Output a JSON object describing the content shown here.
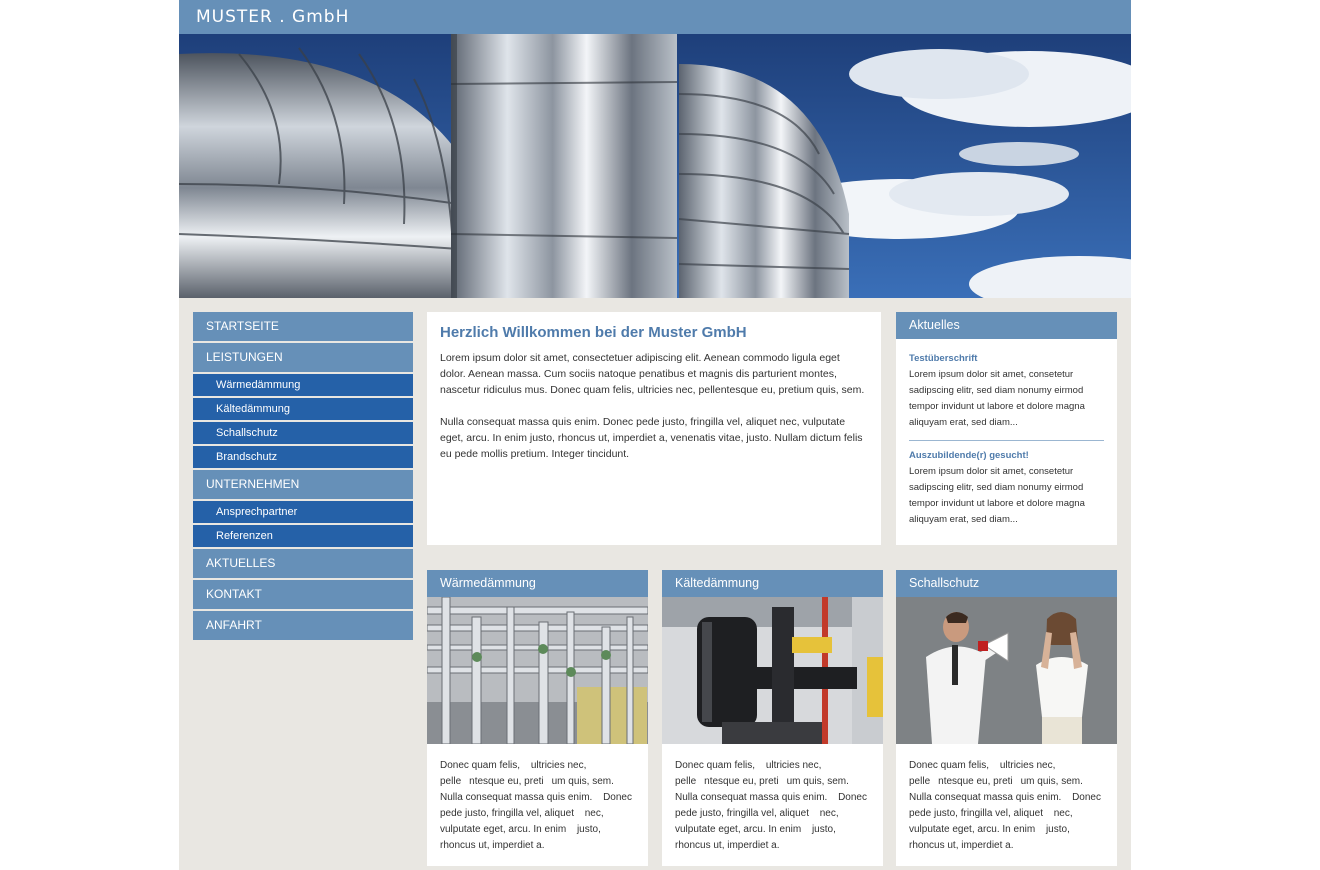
{
  "header": {
    "logo": "MUSTER . GmbH"
  },
  "nav": {
    "items": [
      {
        "label": "STARTSEITE"
      },
      {
        "label": "LEISTUNGEN",
        "sub": [
          "Wärmedämmung",
          "Kältedämmung",
          "Schallschutz",
          "Brandschutz"
        ]
      },
      {
        "label": "UNTERNEHMEN",
        "sub": [
          "Ansprechpartner",
          "Referenzen"
        ]
      },
      {
        "label": "AKTUELLES"
      },
      {
        "label": "KONTAKT"
      },
      {
        "label": "ANFAHRT"
      }
    ]
  },
  "welcome": {
    "title": "Herzlich Willkommen bei der Muster GmbH",
    "p1": "Lorem ipsum dolor sit amet, consectetuer adipiscing elit. Aenean commodo ligula eget dolor. Aenean massa. Cum sociis natoque penatibus et magnis dis parturient montes, nascetur ridiculus mus. Donec quam felis, ultricies nec, pellentesque eu, pretium quis, sem.",
    "p2": "Nulla consequat massa quis enim. Donec pede justo, fringilla vel, aliquet nec, vulputate eget, arcu. In enim justo, rhoncus ut, imperdiet a, venenatis vitae, justo. Nullam dictum felis eu pede mollis pretium. Integer tincidunt."
  },
  "news": {
    "title": "Aktuelles",
    "items": [
      {
        "title": "Testüberschrift",
        "text": "Lorem ipsum dolor sit amet, consetetur sadipscing elitr, sed diam nonumy eirmod tempor invidunt ut labore et dolore magna aliquyam erat, sed diam..."
      },
      {
        "title": "Auszubildende(r) gesucht!",
        "text": "Lorem ipsum dolor sit amet, consetetur sadipscing elitr, sed diam nonumy eirmod tempor invidunt ut labore et dolore magna aliquyam erat, sed diam..."
      }
    ]
  },
  "cards": [
    {
      "title": "Wärmedämmung",
      "text": "Donec quam felis, ultricies nec, pellentesque eu, pretium quis, sem. Nulla consequat massa quis enim. Donec pede justo, fringilla vel, aliquet nec, vulputate eget, arcu. In enim justo, rhoncus ut, imperdiet a."
    },
    {
      "title": "Kältedämmung",
      "text": "Donec quam felis, ultricies nec, pellentesque eu, pretium quis, sem. Nulla consequat massa quis enim. Donec pede justo, fringilla vel, aliquet nec, vulputate eget, arcu. In enim justo, rhoncus ut, imperdiet a."
    },
    {
      "title": "Schallschutz",
      "text": "Donec quam felis, ultricies nec, pellentesque eu, pretium quis, sem. Nulla consequat massa quis enim. Donec pede justo, fringilla vel, aliquet nec, vulputate eget, arcu. In enim justo, rhoncus ut, imperdiet a."
    }
  ],
  "colors": {
    "primary": "#6690b8",
    "subnav": "#2561a8",
    "background": "#e9e7e2",
    "heading": "#4f7bab"
  }
}
